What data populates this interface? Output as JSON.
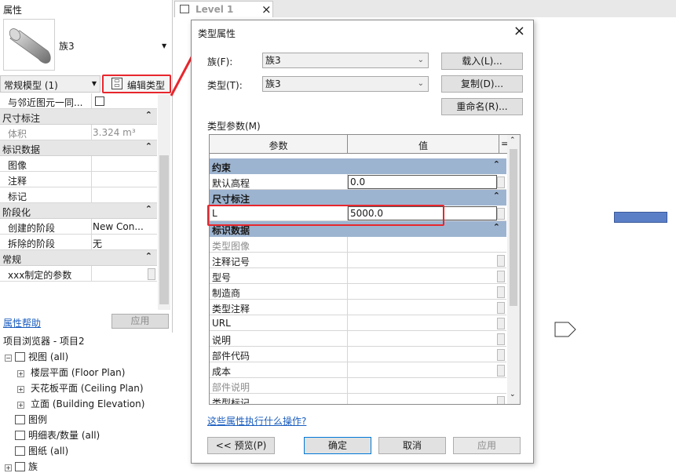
{
  "properties": {
    "title": "属性",
    "family_name": "族3",
    "type_selector": "常规模型 (1)",
    "edit_type": "编辑类型",
    "rows": [
      {
        "kind": "row",
        "key": "与邻近图元一同...",
        "value": ""
      },
      {
        "kind": "group",
        "key": "尺寸标注"
      },
      {
        "kind": "row",
        "key": "体积",
        "value": "3.324 m³",
        "gray": true
      },
      {
        "kind": "group",
        "key": "标识数据"
      },
      {
        "kind": "row",
        "key": "图像",
        "value": ""
      },
      {
        "kind": "row",
        "key": "注释",
        "value": ""
      },
      {
        "kind": "row",
        "key": "标记",
        "value": ""
      },
      {
        "kind": "group",
        "key": "阶段化"
      },
      {
        "kind": "row",
        "key": "创建的阶段",
        "value": "New Con..."
      },
      {
        "kind": "row",
        "key": "拆除的阶段",
        "value": "无"
      },
      {
        "kind": "group",
        "key": "常规"
      },
      {
        "kind": "row",
        "key": "xxx制定的参数",
        "value": ""
      }
    ],
    "help": "属性帮助",
    "apply": "应用"
  },
  "tab": {
    "label": "Level 1",
    "close": "×"
  },
  "dialog": {
    "title": "类型属性",
    "family_label": "族(F):",
    "family_value": "族3",
    "type_label": "类型(T):",
    "type_value": "族3",
    "load": "载入(L)...",
    "duplicate": "复制(D)...",
    "rename": "重命名(R)...",
    "params_label": "类型参数(M)",
    "col_param": "参数",
    "col_value": "值",
    "col_eq": "=",
    "rows": [
      {
        "kind": "group",
        "key": "约束"
      },
      {
        "kind": "row",
        "key": "默认高程",
        "value": "0.0",
        "edit": true
      },
      {
        "kind": "group",
        "key": "尺寸标注"
      },
      {
        "kind": "row",
        "key": "L",
        "value": "5000.0",
        "edit": true
      },
      {
        "kind": "group",
        "key": "标识数据"
      },
      {
        "kind": "row",
        "key": "类型图像",
        "value": "",
        "gray": true
      },
      {
        "kind": "row",
        "key": "注释记号",
        "value": ""
      },
      {
        "kind": "row",
        "key": "型号",
        "value": ""
      },
      {
        "kind": "row",
        "key": "制造商",
        "value": ""
      },
      {
        "kind": "row",
        "key": "类型注释",
        "value": ""
      },
      {
        "kind": "row",
        "key": "URL",
        "value": ""
      },
      {
        "kind": "row",
        "key": "说明",
        "value": ""
      },
      {
        "kind": "row",
        "key": "部件代码",
        "value": ""
      },
      {
        "kind": "row",
        "key": "成本",
        "value": ""
      },
      {
        "kind": "row",
        "key": "部件说明",
        "value": "",
        "gray": true
      },
      {
        "kind": "row",
        "key": "类型标记",
        "value": ""
      }
    ],
    "help_link": "这些属性执行什么操作?",
    "preview": "<< 预览(P)",
    "ok": "确定",
    "cancel": "取消",
    "apply": "应用"
  },
  "browser": {
    "title": "项目浏览器 - 项目2",
    "items": [
      {
        "label": "视图 (all)",
        "level": 0,
        "exp": "⊟",
        "icon": "views-icon"
      },
      {
        "label": "楼层平面 (Floor Plan)",
        "level": 1,
        "exp": "⊞",
        "icon": ""
      },
      {
        "label": "天花板平面 (Ceiling Plan)",
        "level": 1,
        "exp": "⊞",
        "icon": ""
      },
      {
        "label": "立面 (Building Elevation)",
        "level": 1,
        "exp": "⊞",
        "icon": ""
      },
      {
        "label": "图例",
        "level": 0,
        "exp": "",
        "icon": "legend-icon"
      },
      {
        "label": "明细表/数量 (all)",
        "level": 0,
        "exp": "",
        "icon": "schedule-icon"
      },
      {
        "label": "图纸 (all)",
        "level": 0,
        "exp": "",
        "icon": "sheet-icon"
      },
      {
        "label": "族",
        "level": 0,
        "exp": "⊞",
        "icon": "family-icon"
      }
    ]
  },
  "colors": {
    "accent": "#e8262d",
    "group_blue": "#9db4d0",
    "link": "#1a5dbf"
  }
}
